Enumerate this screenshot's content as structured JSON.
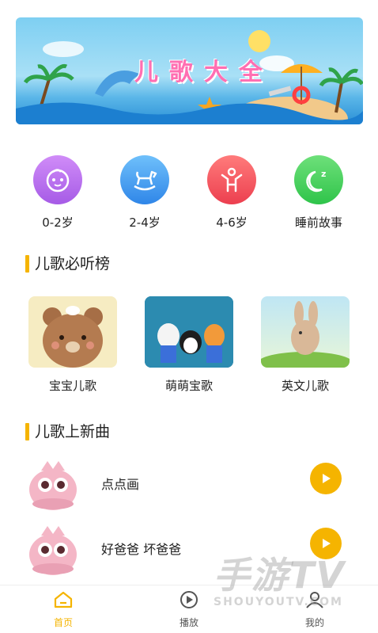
{
  "banner": {
    "title": "儿歌大全"
  },
  "categories": [
    {
      "label": "0-2岁",
      "color": "#b86cf0",
      "icon": "baby-face-icon"
    },
    {
      "label": "2-4岁",
      "color": "#3d9ff0",
      "icon": "rocking-horse-icon"
    },
    {
      "label": "4-6岁",
      "color": "#f0505a",
      "icon": "child-icon"
    },
    {
      "label": "睡前故事",
      "color": "#3fce5a",
      "icon": "moon-sleep-icon"
    }
  ],
  "section_hot": {
    "title": "儿歌必听榜"
  },
  "cards": [
    {
      "label": "宝宝儿歌"
    },
    {
      "label": "萌萌宝歌"
    },
    {
      "label": "英文儿歌"
    }
  ],
  "section_new": {
    "title": "儿歌上新曲"
  },
  "songs": [
    {
      "title": "点点画"
    },
    {
      "title": "好爸爸 坏爸爸"
    }
  ],
  "nav": [
    {
      "label": "首页",
      "icon": "home-icon",
      "active": true
    },
    {
      "label": "播放",
      "icon": "play-circle-icon",
      "active": false
    },
    {
      "label": "我的",
      "icon": "user-icon",
      "active": false
    }
  ],
  "colors": {
    "accent": "#f5b400",
    "nav_active": "#f5b400",
    "text": "#222222"
  },
  "watermark": {
    "big": "手游TV",
    "small": "SHOUYOUTV.COM"
  }
}
